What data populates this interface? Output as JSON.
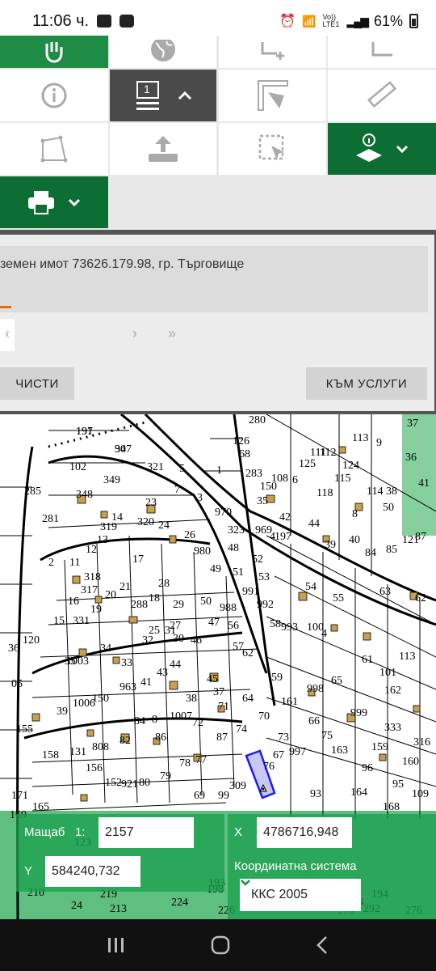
{
  "status_bar": {
    "time": "11:06 ч.",
    "network": "Vo)) LTE1",
    "battery": "61%"
  },
  "toolbar": {
    "layer_number": "1"
  },
  "info_panel": {
    "title": "земен имот 73626.179.98, гр. Търговище",
    "clear_button": "ЧИСТИ",
    "services_button": "КЪМ УСЛУГИ",
    "pager_next": "›",
    "pager_last": "»",
    "pager_prev": "‹"
  },
  "map": {
    "labels": [
      "191",
      "947",
      "102",
      "349",
      "321",
      "5",
      "7",
      "3",
      "1",
      "285",
      "348",
      "23",
      "281",
      "14",
      "319",
      "320",
      "24",
      "970",
      "323",
      "969",
      "197",
      "17",
      "26",
      "980",
      "48",
      "52",
      "53",
      "12",
      "13",
      "11",
      "318",
      "21",
      "28",
      "49",
      "51",
      "16",
      "317",
      "20",
      "19",
      "288",
      "29",
      "50",
      "988",
      "991",
      "992",
      "54",
      "55",
      "15",
      "331",
      "18",
      "25",
      "27",
      "120",
      "34",
      "33",
      "32",
      "31",
      "30",
      "46",
      "47",
      "56",
      "57",
      "58",
      "993",
      "100",
      "4",
      "1003",
      "35",
      "36",
      "05",
      "963",
      "41",
      "43",
      "44",
      "45",
      "62",
      "59",
      "61",
      "101",
      "113",
      "150",
      "1006",
      "39",
      "38",
      "37",
      "71",
      "64",
      "65",
      "998",
      "162",
      "161",
      "1007",
      "8",
      "72",
      "74",
      "70",
      "66",
      "999",
      "333",
      "316",
      "155",
      "131",
      "808",
      "82",
      "84",
      "86",
      "87",
      "73",
      "75",
      "67",
      "997",
      "163",
      "159",
      "160",
      "158",
      "156",
      "152",
      "921",
      "80",
      "79",
      "78",
      "77",
      "76",
      "69",
      "309",
      "99",
      "93",
      "96",
      "95",
      "109",
      "164",
      "168",
      "171",
      "165",
      "169",
      "123",
      "210",
      "24",
      "219",
      "213",
      "224",
      "226",
      "193",
      "198",
      "194",
      "292",
      "276",
      "278",
      "274",
      "280",
      "283",
      "150",
      "108",
      "6",
      "125",
      "111",
      "112",
      "113",
      "9",
      "37",
      "36",
      "35",
      "118",
      "124",
      "115",
      "114",
      "38",
      "41",
      "42",
      "44",
      "8",
      "39",
      "40",
      "84",
      "85",
      "121",
      "87",
      "63",
      "62",
      "68",
      "126",
      "2",
      "4",
      "50",
      "197",
      "30"
    ],
    "parcel_highlight": "73626.179.98"
  },
  "controls": {
    "scale_label": "Мащаб",
    "scale_prefix": "1:",
    "scale_value": "2157",
    "x_label": "X",
    "x_value": "4786716,948",
    "y_label": "Y",
    "y_value": "584240,732",
    "coord_system_label": "Координатна система",
    "coord_system_value": "ККС 2005"
  },
  "colors": {
    "green": "#1e8c45",
    "dark_green": "#0d6e34",
    "selection": "#1a1aff",
    "building": "#c8a050"
  }
}
